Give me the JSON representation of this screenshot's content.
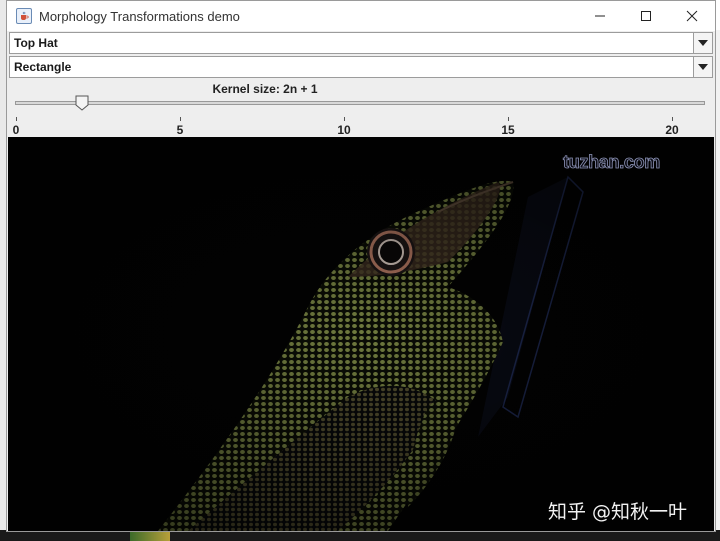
{
  "window": {
    "title": "Morphology Transformations demo"
  },
  "controls": {
    "operation_select": {
      "value": "Top Hat"
    },
    "shape_select": {
      "value": "Rectangle"
    },
    "kernel_slider": {
      "label": "Kernel size: 2n + 1",
      "min": 0,
      "max": 20,
      "value": 2,
      "tick_labels": [
        "0",
        "5",
        "10",
        "15",
        "20"
      ]
    }
  },
  "image": {
    "watermark_top": "tuzhan.com",
    "watermark_bottom": "知乎 @知秋一叶"
  },
  "icons": {
    "app": "java-cup-icon",
    "minimize": "minimize-icon",
    "maximize": "maximize-icon",
    "close": "close-icon",
    "dropdown": "triangle-down-icon"
  }
}
